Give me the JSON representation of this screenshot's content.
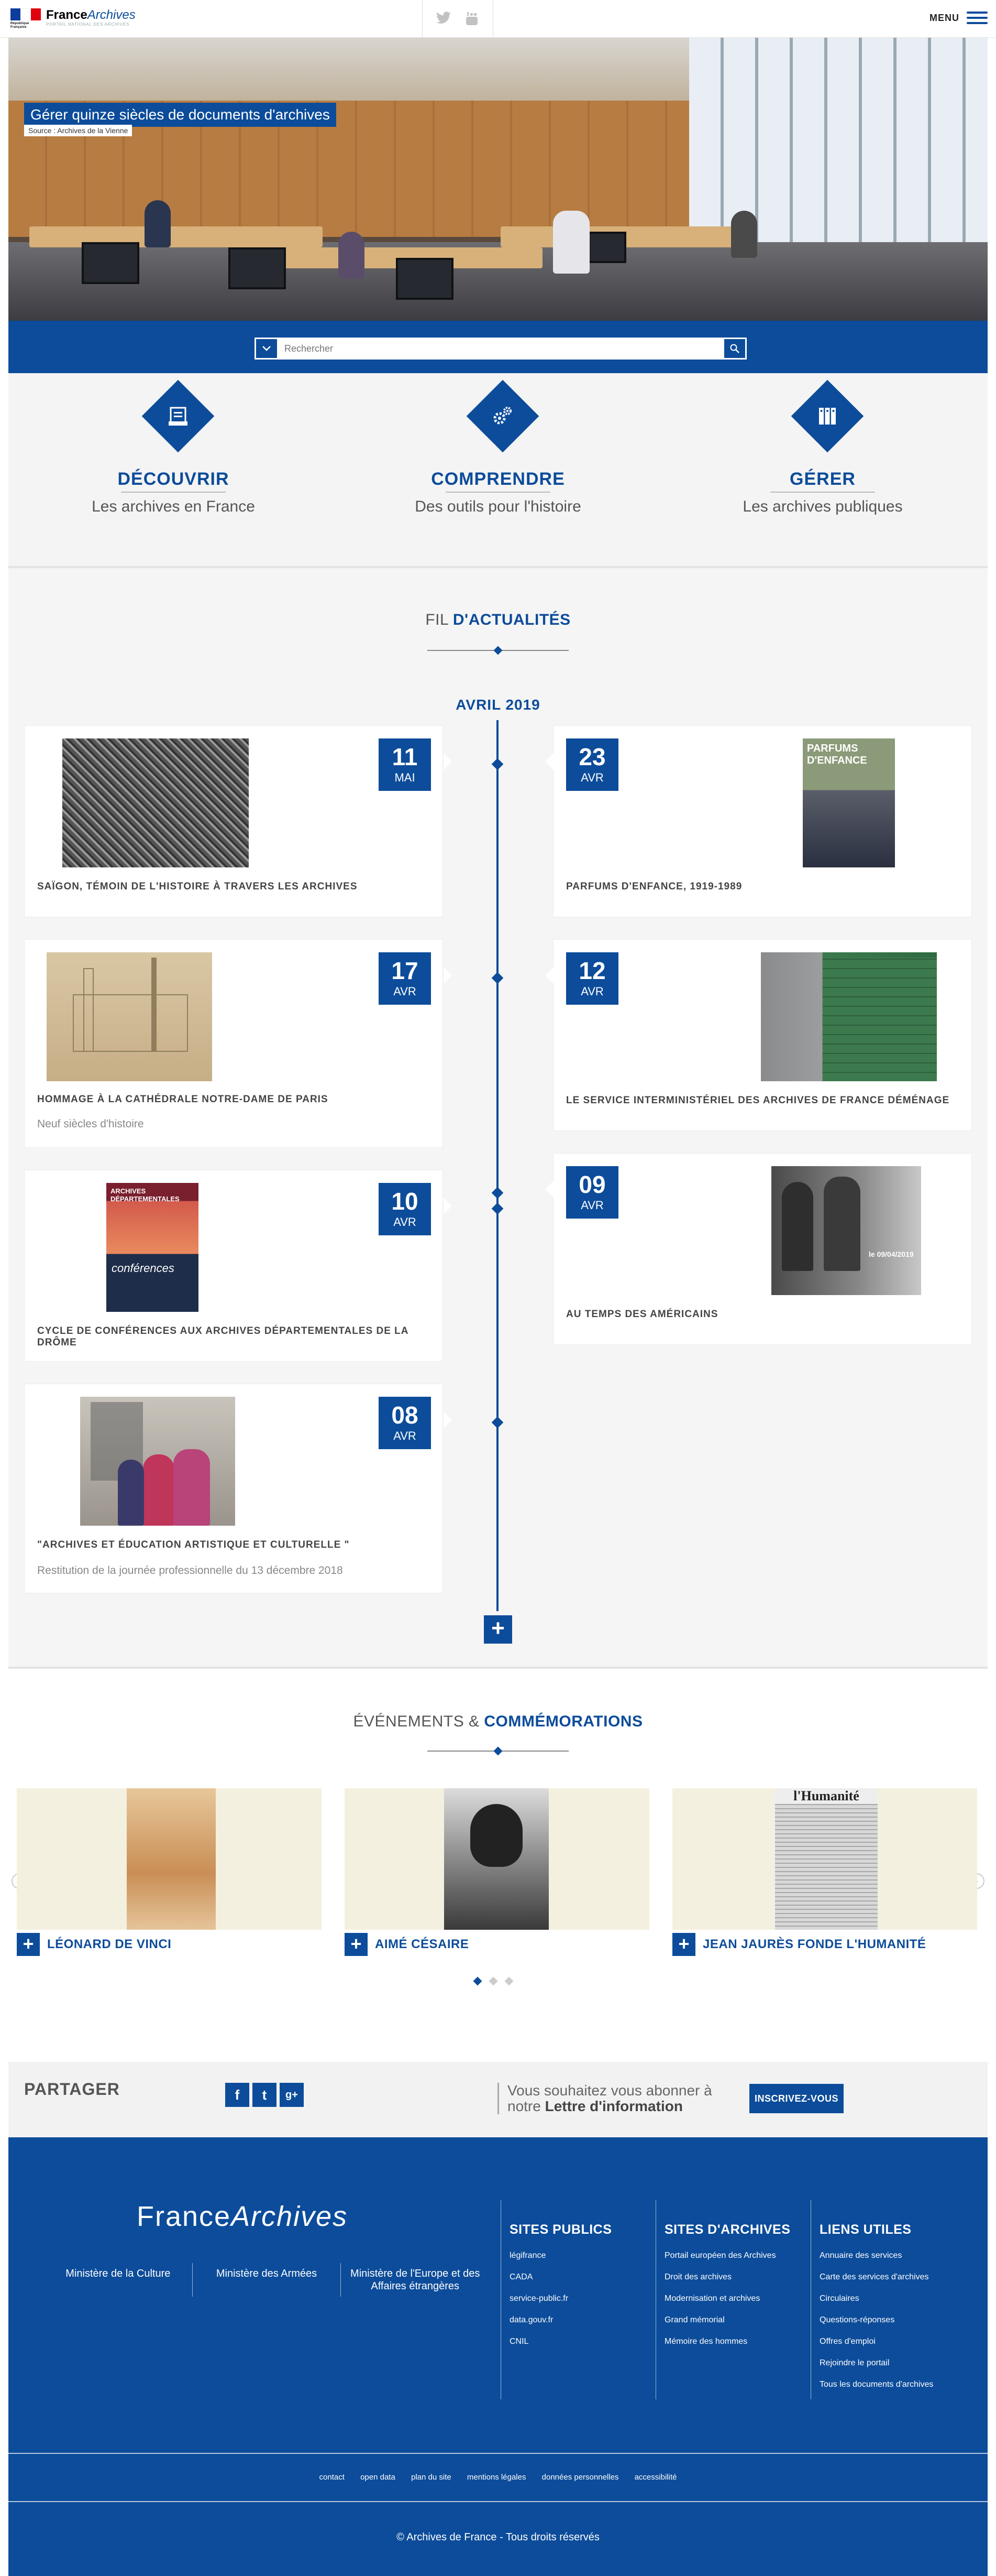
{
  "header": {
    "brand_strong": "France",
    "brand_italic": "Archives",
    "brand_tagline": "Portail national des archives",
    "flag_caption": "République Française",
    "menu_label": "MENU",
    "social": [
      "twitter-icon",
      "youtube-icon"
    ]
  },
  "hero": {
    "title": "Gérer quinze siècles de documents d'archives",
    "source": "Source : Archives de la Vienne"
  },
  "search": {
    "placeholder": "Rechercher"
  },
  "features": [
    {
      "title": "DÉCOUVRIR",
      "subtitle": "Les archives en France",
      "icon": "archive-box-icon"
    },
    {
      "title": "COMPRENDRE",
      "subtitle": "Des outils pour l'histoire",
      "icon": "gears-icon"
    },
    {
      "title": "GÉRER",
      "subtitle": "Les archives publiques",
      "icon": "binders-icon"
    }
  ],
  "news": {
    "title_plain": "FIL ",
    "title_strong": "D'ACTUALITÉS",
    "month": "AVRIL 2019",
    "items": [
      {
        "day": "11",
        "month": "MAI",
        "title": "SAÏGON, TÉMOIN DE L'HISTOIRE À TRAVERS LES ARCHIVES",
        "subtitle": ""
      },
      {
        "day": "23",
        "month": "AVR",
        "title": "PARFUMS D'ENFANCE, 1919-1989",
        "subtitle": "",
        "img_text_1": "PARFUMS",
        "img_text_2": "D'ENFANCE"
      },
      {
        "day": "17",
        "month": "AVR",
        "title": "HOMMAGE À LA CATHÉDRALE NOTRE-DAME DE PARIS",
        "subtitle": "Neuf siècles d'histoire"
      },
      {
        "day": "12",
        "month": "AVR",
        "title": "LE SERVICE INTERMINISTÉRIEL DES ARCHIVES DE FRANCE DÉMÉNAGE",
        "subtitle": ""
      },
      {
        "day": "10",
        "month": "AVR",
        "title": "CYCLE DE CONFÉRENCES AUX ARCHIVES DÉPARTEMENTALES DE LA DRÔME",
        "subtitle": "",
        "img_text_1": "ARCHIVES DÉPARTEMENTALES",
        "img_text_2": "conférences"
      },
      {
        "day": "09",
        "month": "AVR",
        "title": "AU TEMPS DES AMÉRICAINS",
        "subtitle": "",
        "img_text_1": "le 09/04/2019"
      },
      {
        "day": "08",
        "month": "AVR",
        "title": "\"ARCHIVES ET ÉDUCATION ARTISTIQUE ET CULTURELLE \"",
        "subtitle": "Restitution de la journée professionnelle du 13 décembre 2018"
      }
    ],
    "more_label": "+"
  },
  "events": {
    "title_plain": "ÉVÉNEMENTS & ",
    "title_strong": "COMMÉMORATIONS",
    "items": [
      {
        "name": "LÉONARD DE VINCI"
      },
      {
        "name": "AIMÉ CÉSAIRE"
      },
      {
        "name": "JEAN JAURÈS FONDE L'HUMANITÉ",
        "img_text": "l'Humanité"
      }
    ],
    "plus_label": "+",
    "prev": "‹",
    "next": "›"
  },
  "share": {
    "label": "PARTAGER",
    "icons": [
      {
        "name": "facebook-icon",
        "glyph": "f"
      },
      {
        "name": "twitter-icon",
        "glyph": "t"
      },
      {
        "name": "googleplus-icon",
        "glyph": "g+"
      }
    ],
    "newsletter_text": "Vous souhaitez vous abonner à notre ",
    "newsletter_strong": "Lettre d'information",
    "subscribe": "INSCRIVEZ-VOUS"
  },
  "footer": {
    "brand_plain": "France",
    "brand_italic": "Archives",
    "ministries": [
      "Ministère de la Culture",
      "Ministère des Armées",
      "Ministère de l'Europe et des Affaires étrangères"
    ],
    "columns": [
      {
        "title": "SITES PUBLICS",
        "links": [
          "légifrance",
          "CADA",
          "service-public.fr",
          "data.gouv.fr",
          "CNIL"
        ]
      },
      {
        "title": "SITES D'ARCHIVES",
        "links": [
          "Portail européen des Archives",
          "Droit des archives",
          "Modernisation et archives",
          "Grand mémorial",
          "Mémoire des hommes"
        ]
      },
      {
        "title": "LIENS UTILES",
        "links": [
          "Annuaire des services",
          "Carte des services d'archives",
          "Circulaires",
          "Questions-réponses",
          "Offres d'emploi",
          "Rejoindre le portail",
          "Tous les documents d'archives"
        ]
      }
    ],
    "bottom_links": [
      "contact",
      "open data",
      "plan du site",
      "mentions légales",
      "données personnelles",
      "accessibilité"
    ],
    "copyright": "© Archives de France - Tous droits réservés"
  },
  "colors": {
    "accent": "#0c4c9a",
    "flag_blue": "#0d3c9c",
    "flag_red": "#e1000f"
  }
}
